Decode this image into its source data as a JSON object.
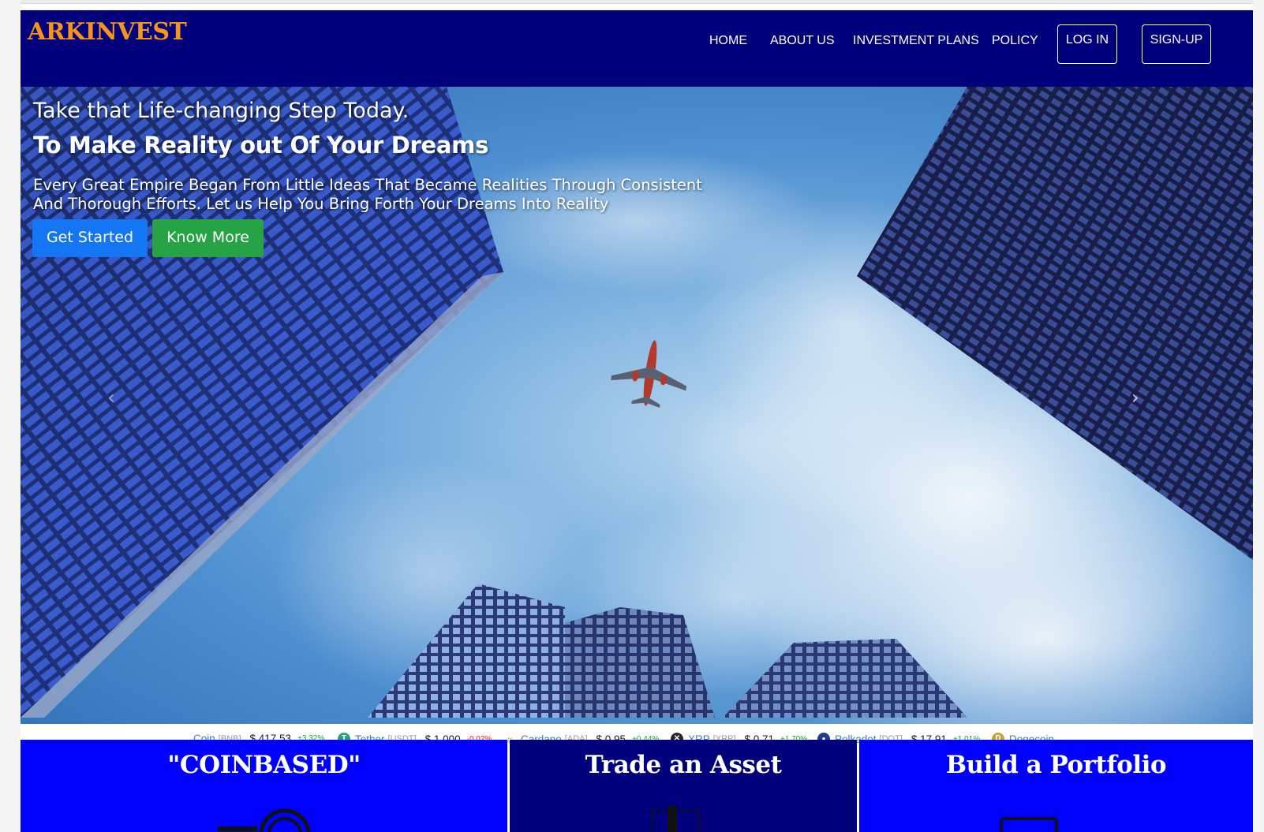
{
  "brand": {
    "name": "ARKINVEST",
    "color": "#f7941d"
  },
  "nav": {
    "links": [
      "HOME",
      "ABOUT US",
      "INVESTMENT PLANS",
      "POLICY"
    ],
    "login_label": "LOG IN",
    "signup_label": "SIGN-UP",
    "background": "#00007d"
  },
  "hero": {
    "line1": "Take that Life-changing Step Today.",
    "line2": "To Make Reality out Of Your Dreams",
    "description": "Every Great Empire Began From Little Ideas That Became Realities Through Consistent And Thorough Efforts. Let us Help You Bring Forth Your Dreams Into Reality",
    "primary_button": "Get Started",
    "secondary_button": "Know More",
    "next_arrow": "›",
    "prev_arrow": "‹"
  },
  "ticker": [
    {
      "name": "Coin",
      "symbol": "[BNB]",
      "price": "$ 417.53",
      "change": "+3.32%",
      "direction": "up",
      "icon": "bnb-icon",
      "icon_color": ""
    },
    {
      "name": "Tether",
      "symbol": "[USDT]",
      "price": "$ 1.000",
      "change": "-0.02%",
      "direction": "down",
      "icon": "tether-icon",
      "icon_color": "#26a17b",
      "icon_glyph": "T"
    },
    {
      "name": "Cardano",
      "symbol": "[ADA]",
      "price": "$ 0.95",
      "change": "+0.44%",
      "direction": "up",
      "icon": "cardano-icon",
      "icon_color": "#ffffff",
      "icon_glyph": "☼"
    },
    {
      "name": "XRP",
      "symbol": "[XRP]",
      "price": "$ 0.71",
      "change": "+1.70%",
      "direction": "up",
      "icon": "xrp-icon",
      "icon_color": "#23292f",
      "icon_glyph": "✕"
    },
    {
      "name": "Polkadot",
      "symbol": "[DOT]",
      "price": "$ 17.91",
      "change": "+1.01%",
      "direction": "up",
      "icon": "polkadot-icon",
      "icon_color": "#1d3c8a",
      "icon_glyph": "●"
    },
    {
      "name": "Dogecoin",
      "symbol": "",
      "price": "",
      "change": "",
      "direction": "",
      "icon": "dogecoin-icon",
      "icon_color": "#c2a633",
      "icon_glyph": "D"
    }
  ],
  "cards": [
    {
      "title": "\"COINBASED\"",
      "color": "#0000ff"
    },
    {
      "title": "Trade an Asset",
      "color": "#00007d"
    },
    {
      "title": "Build a Portfolio",
      "color": "#0000ff"
    }
  ]
}
